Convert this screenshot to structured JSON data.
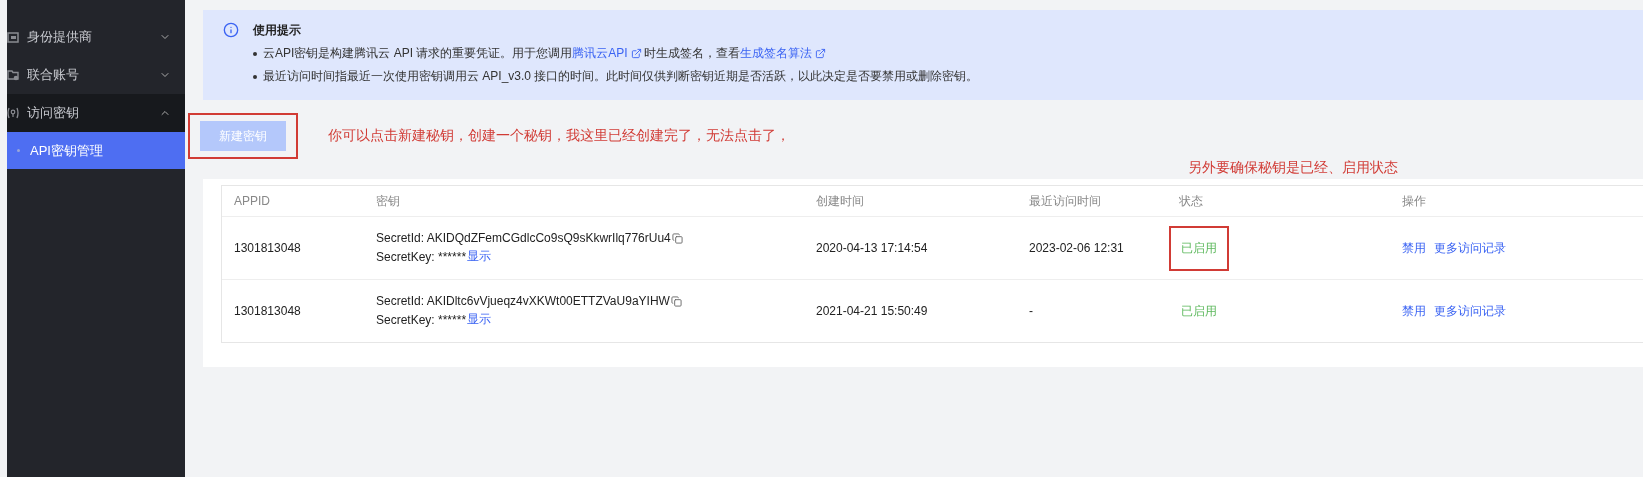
{
  "sidebar": {
    "items": [
      {
        "label": "身份提供商",
        "kind": "id",
        "expanded": false,
        "selected": false
      },
      {
        "label": "联合账号",
        "kind": "account",
        "expanded": false,
        "selected": false
      },
      {
        "label": "访问密钥",
        "kind": "key",
        "expanded": true,
        "selected": false,
        "children": [
          {
            "label": "API密钥管理",
            "selected": true
          }
        ]
      }
    ]
  },
  "notice": {
    "title": "使用提示",
    "lines": [
      [
        {
          "kind": "text",
          "text": "云API密钥是构建腾讯云 API 请求的重要凭证。用于您调用"
        },
        {
          "kind": "link",
          "text": "腾讯云API"
        },
        {
          "kind": "text",
          "text": "时生成签名，查看"
        },
        {
          "kind": "link",
          "text": "生成签名算法"
        }
      ],
      [
        {
          "kind": "text",
          "text": "最近访问时间指最近一次使用密钥调用云 API_v3.0 接口的时间。此时间仅供判断密钥近期是否活跃，以此决定是否要禁用或删除密钥。"
        }
      ]
    ]
  },
  "create_button": {
    "label": "新建密钥",
    "disabled": true,
    "highlighted": true
  },
  "annotations": [
    "你可以点击新建秘钥，创建一个秘钥，我这里已经创建完了，无法点击了，",
    "另外要确保秘钥是已经、启用状态"
  ],
  "table": {
    "columns": [
      "APPID",
      "密钥",
      "创建时间",
      "最近访问时间",
      "状态",
      "操作"
    ],
    "rows": [
      {
        "appid": "1301813048",
        "secret_id": "SecretId: AKIDQdZFemCGdlcCo9sQ9sKkwrIlq776rUu4",
        "secret_key": "SecretKey: ******",
        "show": "显示",
        "created": "2020-04-13 17:14:54",
        "last_access": "2023-02-06 12:31",
        "status": "已启用",
        "highlighted": true,
        "actions": [
          "禁用",
          "更多访问记录"
        ]
      },
      {
        "appid": "1301813048",
        "secret_id": "SecretId: AKIDltc6vVjueqz4vXKWt00ETTZVaU9aYIHW",
        "secret_key": "SecretKey: ******",
        "show": "显示",
        "created": "2021-04-21 15:50:49",
        "last_access": "-",
        "status": "已启用",
        "highlighted": false,
        "actions": [
          "禁用",
          "更多访问记录"
        ]
      }
    ]
  }
}
